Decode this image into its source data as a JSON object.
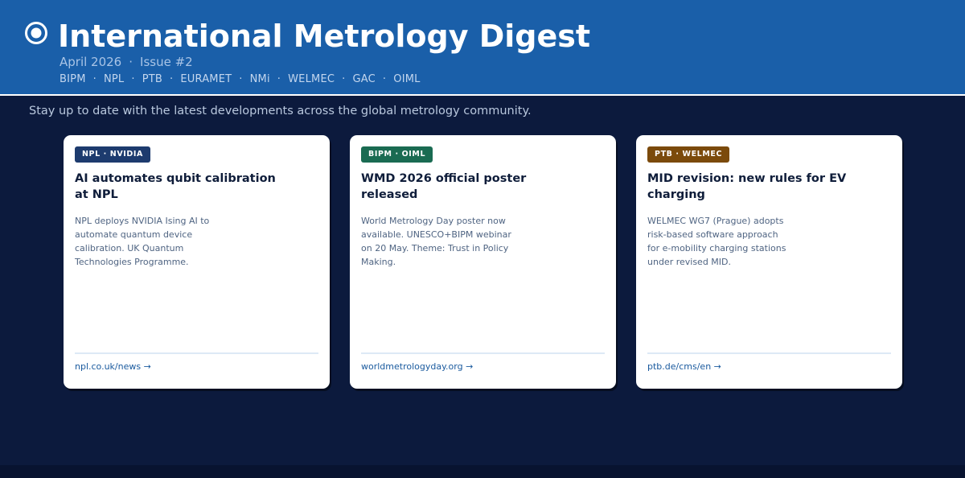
{
  "header": {
    "title": "International Metrology Digest",
    "date": "April 2026",
    "separator": "·",
    "issue": "Issue #2",
    "orgs": [
      "BIPM",
      "NPL",
      "PTB",
      "EURAMET",
      "NMi",
      "WELMEC",
      "GAC",
      "OIML"
    ]
  },
  "tagline": "Stay up to date with the latest developments across the global metrology community.",
  "cards": [
    {
      "badge": "NPL · NVIDIA",
      "badge_color": "#1d3b6e",
      "title": "AI automates qubit calibration at NPL",
      "body": "NPL deploys NVIDIA Ising AI to automate quantum device calibration. UK Quantum Technologies Programme.",
      "link": "npl.co.uk/news →"
    },
    {
      "badge": "BIPM · OIML",
      "badge_color": "#1a6b52",
      "title": "WMD 2026 official poster released",
      "body": "World Metrology Day poster now available. UNESCO+BIPM webinar on 20 May. Theme: Trust in Policy Making.",
      "link": "worldmetrologyday.org →"
    },
    {
      "badge": "PTB · WELMEC",
      "badge_color": "#7b4a0b",
      "title": "MID revision: new rules for EV charging",
      "body": "WELMEC WG7 (Prague) adopts risk-based software approach for e-mobility charging stations under revised MID.",
      "link": "ptb.de/cms/en →"
    }
  ],
  "colors": {
    "header_bg": "#1a5fa9",
    "page_bg": "#0c1a3d",
    "link": "#1a5a9e"
  },
  "icons": {
    "logo": "target-circle-icon"
  }
}
